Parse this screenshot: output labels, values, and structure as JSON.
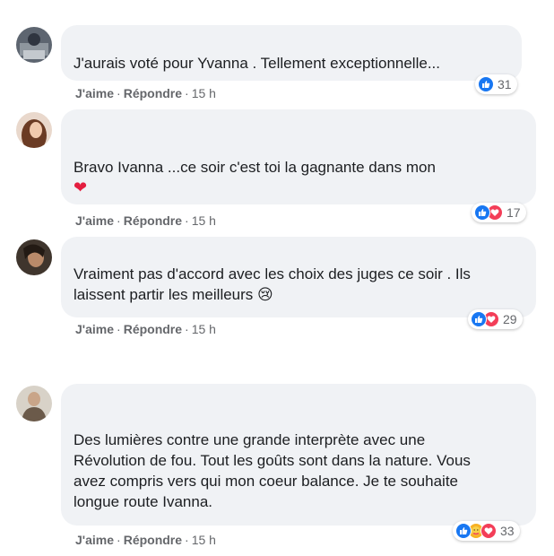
{
  "comments": [
    {
      "text": "J'aurais voté pour Yvanna . Tellement exceptionnelle...",
      "emoji": "",
      "like_label": "J'aime",
      "reply_label": "Répondre",
      "time": "15 h",
      "reaction_count": "31",
      "reactions": [
        "like"
      ]
    },
    {
      "text": "Bravo Ivanna ...ce soir c'est toi la gagnante dans mon",
      "emoji": "❤",
      "like_label": "J'aime",
      "reply_label": "Répondre",
      "time": "15 h",
      "reaction_count": "17",
      "reactions": [
        "like",
        "love"
      ]
    },
    {
      "text": "Vraiment pas d'accord avec les choix des juges ce soir . Ils laissent partir les meilleurs",
      "emoji": "😢",
      "like_label": "J'aime",
      "reply_label": "Répondre",
      "time": "15 h",
      "reaction_count": "29",
      "reactions": [
        "like",
        "love"
      ]
    },
    {
      "text": "Des lumières contre une grande interprète avec une Révolution de fou. Tout les goûts sont dans la nature. Vous avez compris vers qui mon coeur balance. Je te souhaite longue route Ivanna.",
      "emoji": "",
      "like_label": "J'aime",
      "reply_label": "Répondre",
      "time": "15 h",
      "reaction_count": "33",
      "reactions": [
        "like",
        "care",
        "love"
      ]
    }
  ],
  "colors": {
    "bubble": "#f0f2f5",
    "meta": "#65676b",
    "like": "#1877f2",
    "love": "#f33e58",
    "care": "#f7b125"
  }
}
